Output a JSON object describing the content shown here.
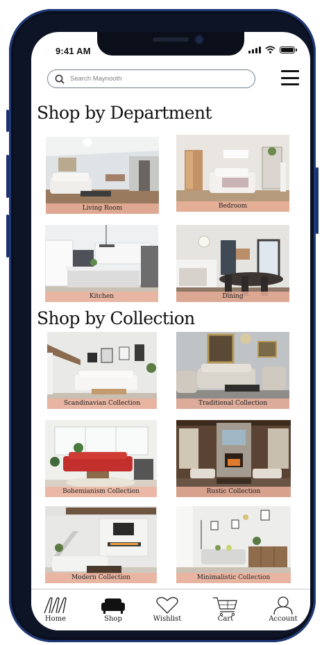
{
  "status": {
    "time": "9:41 AM"
  },
  "search": {
    "placeholder": "Search Maynooth"
  },
  "sections": {
    "department": {
      "title": "Shop by Department"
    },
    "collection": {
      "title": "Shop by Collection"
    }
  },
  "departments": [
    {
      "label": "Living Room",
      "icon": "living-room-photo"
    },
    {
      "label": "Bedroom",
      "icon": "bedroom-photo"
    },
    {
      "label": "Kitchen",
      "icon": "kitchen-photo"
    },
    {
      "label": "Dining",
      "icon": "dining-photo"
    }
  ],
  "collections": [
    {
      "label": "Scandinavian Collection"
    },
    {
      "label": "Traditional Collection"
    },
    {
      "label": "Bohemianism Collection"
    },
    {
      "label": "Rustic Collection"
    },
    {
      "label": "Modern Collection"
    },
    {
      "label": "Minimalistic Collection"
    }
  ],
  "tabs": [
    {
      "label": "Home",
      "icon": "home-logo-icon",
      "active": false
    },
    {
      "label": "Shop",
      "icon": "sofa-icon",
      "active": true
    },
    {
      "label": "Wishlist",
      "icon": "heart-icon",
      "active": false
    },
    {
      "label": "Cart",
      "icon": "cart-icon",
      "active": false
    },
    {
      "label": "Account",
      "icon": "person-icon",
      "active": false
    }
  ],
  "colors": {
    "label_bg": "#eeb29e",
    "frame": "#1f3a78",
    "text": "#111111"
  }
}
